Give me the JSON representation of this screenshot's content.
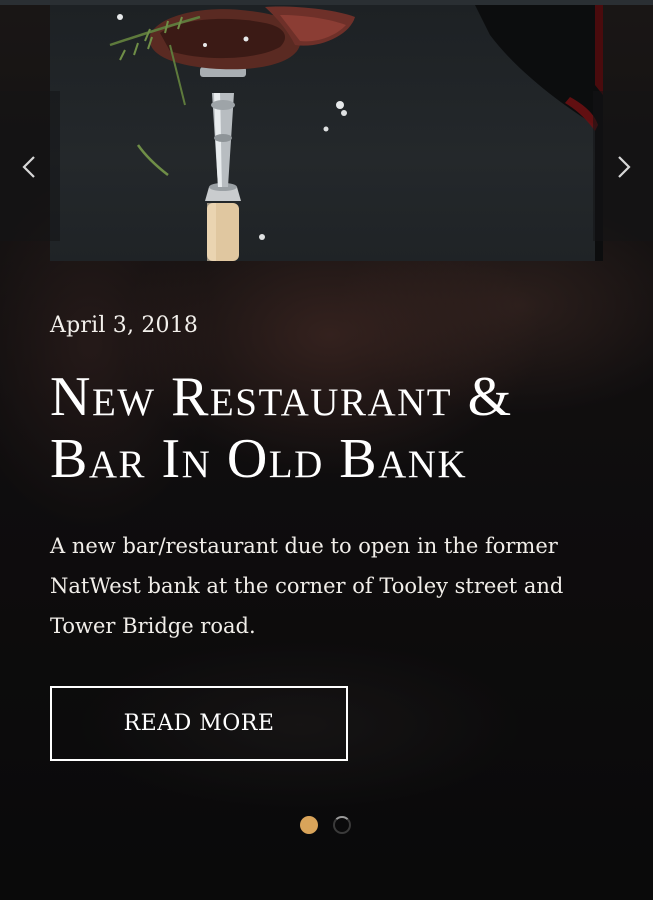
{
  "slider": {
    "post": {
      "date": "April 3, 2018",
      "title": "New Restaurant & Bar In Old Bank",
      "excerpt": "A new bar/restaurant due to open in the former NatWest bank at the corner of Tooley street and Tower Bridge road.",
      "read_more_label": "READ MORE"
    },
    "prev_icon": "chevron-left-icon",
    "next_icon": "chevron-right-icon",
    "total_slides": 2,
    "current_slide": 1
  },
  "colors": {
    "accent": "#d9a45a",
    "background": "#0d0d0e",
    "text": "#ffffff"
  }
}
